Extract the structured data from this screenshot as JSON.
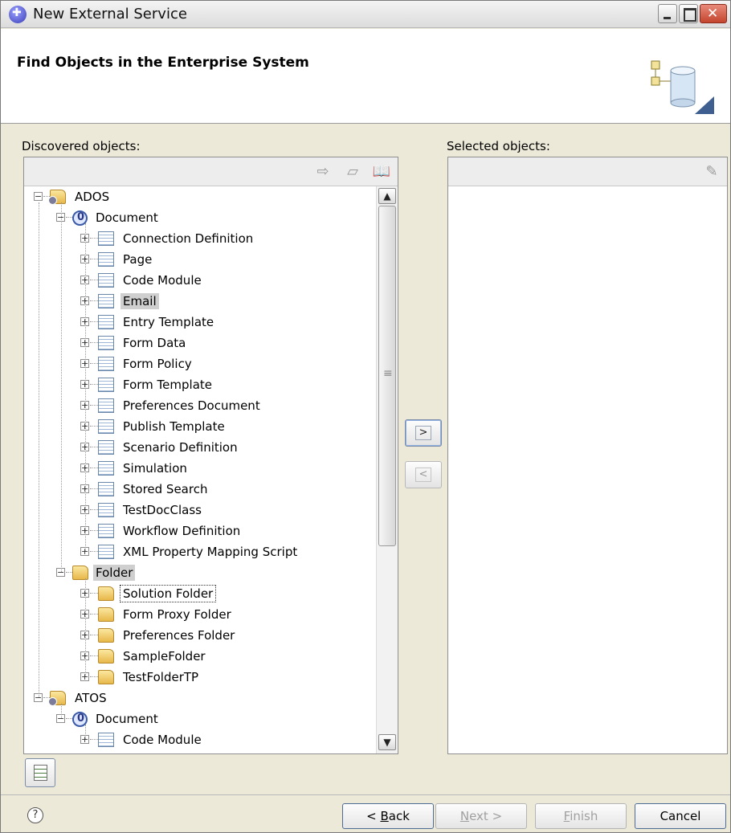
{
  "window": {
    "title": "New External Service"
  },
  "banner": {
    "title": "Find Objects in the Enterprise System"
  },
  "discovered": {
    "label": "Discovered objects:",
    "tree": [
      {
        "label": "ADOS",
        "icon": "project-folder-icon",
        "depth": 0,
        "expanded": true
      },
      {
        "label": "Document",
        "icon": "document-class-icon",
        "depth": 1,
        "expanded": true
      },
      {
        "label": "Connection Definition",
        "icon": "table-icon",
        "depth": 2,
        "expanded": false
      },
      {
        "label": "Page",
        "icon": "table-icon",
        "depth": 2,
        "expanded": false
      },
      {
        "label": "Code Module",
        "icon": "table-icon",
        "depth": 2,
        "expanded": false
      },
      {
        "label": "Email",
        "icon": "table-icon",
        "depth": 2,
        "expanded": false,
        "highlighted": true
      },
      {
        "label": "Entry Template",
        "icon": "table-icon",
        "depth": 2,
        "expanded": false
      },
      {
        "label": "Form Data",
        "icon": "table-icon",
        "depth": 2,
        "expanded": false
      },
      {
        "label": "Form Policy",
        "icon": "table-icon",
        "depth": 2,
        "expanded": false
      },
      {
        "label": "Form Template",
        "icon": "table-icon",
        "depth": 2,
        "expanded": false
      },
      {
        "label": "Preferences Document",
        "icon": "table-icon",
        "depth": 2,
        "expanded": false
      },
      {
        "label": "Publish Template",
        "icon": "table-icon",
        "depth": 2,
        "expanded": false
      },
      {
        "label": "Scenario Definition",
        "icon": "table-icon",
        "depth": 2,
        "expanded": false
      },
      {
        "label": "Simulation",
        "icon": "table-icon",
        "depth": 2,
        "expanded": false
      },
      {
        "label": "Stored Search",
        "icon": "table-icon",
        "depth": 2,
        "expanded": false
      },
      {
        "label": "TestDocClass",
        "icon": "table-icon",
        "depth": 2,
        "expanded": false
      },
      {
        "label": "Workflow Definition",
        "icon": "table-icon",
        "depth": 2,
        "expanded": false
      },
      {
        "label": "XML Property Mapping Script",
        "icon": "table-icon",
        "depth": 2,
        "expanded": false
      },
      {
        "label": "Folder",
        "icon": "folder-icon",
        "depth": 1,
        "expanded": true,
        "highlighted": true
      },
      {
        "label": "Solution Folder",
        "icon": "folder-icon",
        "depth": 2,
        "expanded": false,
        "focused": true
      },
      {
        "label": "Form Proxy Folder",
        "icon": "folder-icon",
        "depth": 2,
        "expanded": false
      },
      {
        "label": "Preferences Folder",
        "icon": "folder-icon",
        "depth": 2,
        "expanded": false
      },
      {
        "label": "SampleFolder",
        "icon": "folder-icon",
        "depth": 2,
        "expanded": false
      },
      {
        "label": "TestFolderTP",
        "icon": "folder-icon",
        "depth": 2,
        "expanded": false
      },
      {
        "label": "ATOS",
        "icon": "project-folder-icon",
        "depth": 0,
        "expanded": true
      },
      {
        "label": "Document",
        "icon": "document-class-icon",
        "depth": 1,
        "expanded": true
      },
      {
        "label": "Code Module",
        "icon": "table-icon",
        "depth": 2,
        "expanded": false
      }
    ]
  },
  "selected": {
    "label": "Selected objects:"
  },
  "buttons": {
    "add": ">",
    "remove": "<",
    "help": "?",
    "back_prefix": "< ",
    "back_key": "B",
    "back_rest": "ack",
    "next_key": "N",
    "next_rest": "ext >",
    "finish_key": "F",
    "finish_rest": "inish",
    "cancel": "Cancel"
  }
}
